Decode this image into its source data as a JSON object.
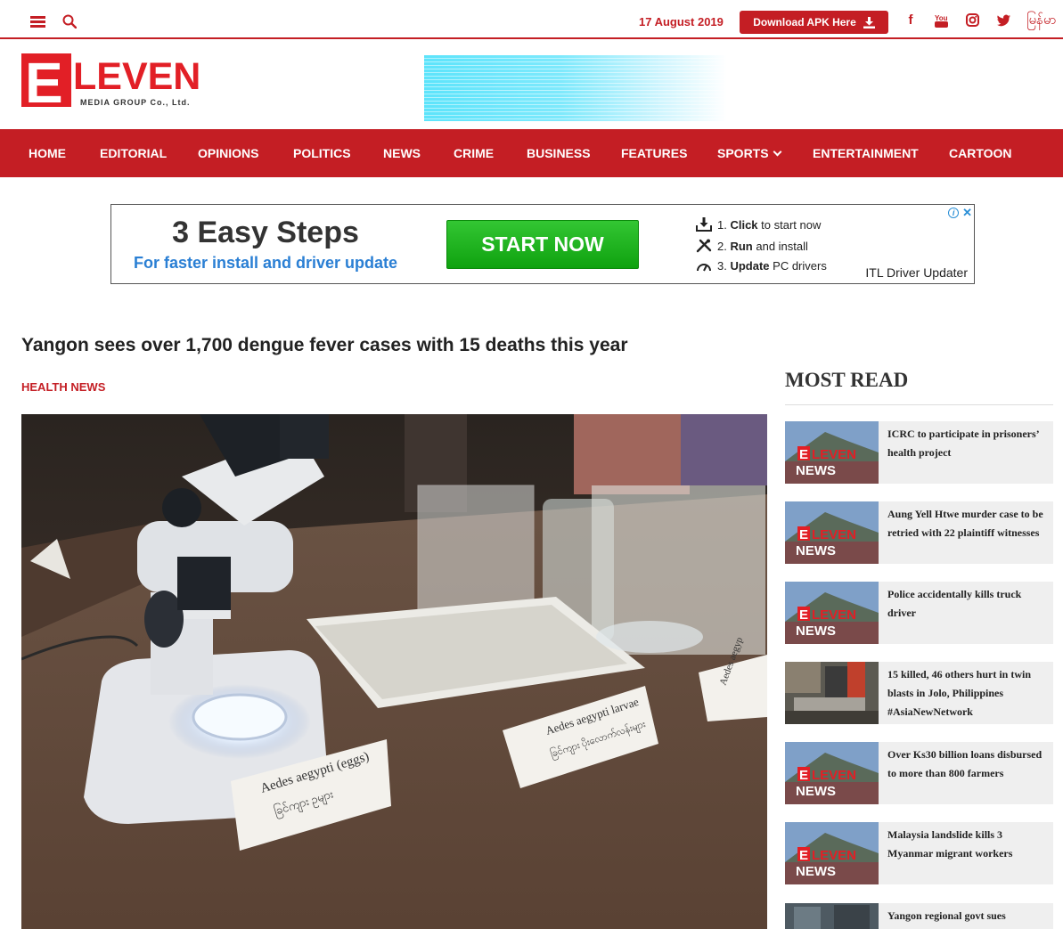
{
  "topbar": {
    "date": "17 August 2019",
    "download_label": "Download APK Here",
    "language_label": "မြန်မာ",
    "social_icons": [
      "facebook-icon",
      "youtube-icon",
      "instagram-icon",
      "twitter-icon"
    ]
  },
  "logo": {
    "letter": "E",
    "word": "LEVEN",
    "subtitle": "MEDIA GROUP Co., Ltd."
  },
  "nav": {
    "items": [
      {
        "label": "HOME"
      },
      {
        "label": "EDITORIAL"
      },
      {
        "label": "OPINIONS"
      },
      {
        "label": "POLITICS"
      },
      {
        "label": "NEWS"
      },
      {
        "label": "CRIME"
      },
      {
        "label": "BUSINESS"
      },
      {
        "label": "FEATURES"
      },
      {
        "label": "SPORTS"
      },
      {
        "label": "ENTERTAINMENT"
      },
      {
        "label": "CARTOON"
      }
    ]
  },
  "ad": {
    "headline": "3 Easy Steps",
    "subline": "For faster install and driver update",
    "button": "START NOW",
    "steps": [
      {
        "num": "1.",
        "bold": "Click",
        "rest": " to start now"
      },
      {
        "num": "2.",
        "bold": "Run",
        "rest": " and install"
      },
      {
        "num": "3.",
        "bold": "Update",
        "rest": " PC drivers"
      }
    ],
    "brand": "ITL Driver Updater",
    "close": "✕"
  },
  "article": {
    "title": "Yangon sees over 1,700 dengue fever cases with 15 deaths this year",
    "category": "HEALTH NEWS",
    "image_labels": {
      "eggs_line1": "Aedes aegypti (eggs)",
      "eggs_line2": "ခြင်ကျား ဥများ",
      "larvae_line1": "Aedes aegypti larvae",
      "larvae_line2": "ခြင်ကျား ပိုးလောက်လန်းများ",
      "adult_line1": "Aedes aegyp"
    }
  },
  "most_read": {
    "title": "MOST READ",
    "thumb_text": {
      "word": "LEVEN",
      "letter": "E",
      "news": "NEWS"
    },
    "items": [
      {
        "title": "ICRC to participate in prisoners’ health project"
      },
      {
        "title": "Aung Yell Htwe murder case to be retried with 22 plaintiff witnesses"
      },
      {
        "title": "Police accidentally kills truck driver"
      },
      {
        "title": "15 killed, 46 others hurt in twin blasts in Jolo, Philippines #AsiaNewNetwork"
      },
      {
        "title": "Over Ks30 billion loans disbursed to more than 800 farmers"
      },
      {
        "title": "Malaysia landslide kills 3 Myanmar migrant workers"
      },
      {
        "title": "Yangon regional govt sues"
      }
    ]
  },
  "colors": {
    "brand_red": "#c41e24",
    "ad_blue": "#2a7fd4",
    "ad_green": "#1fb31f"
  }
}
